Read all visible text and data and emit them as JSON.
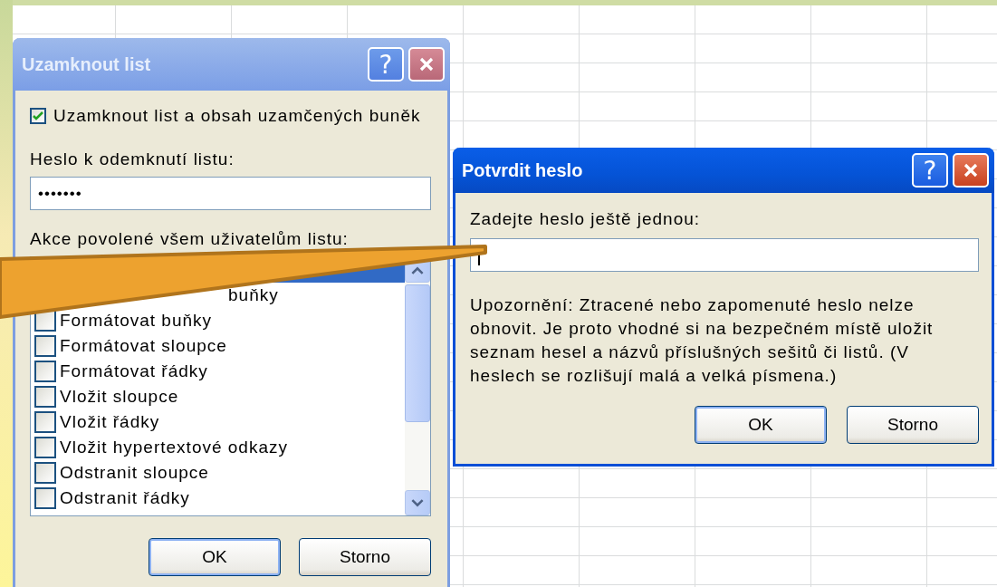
{
  "lock_sheet_dialog": {
    "title": "Uzamknout list",
    "active": false,
    "help_glyph": "?",
    "protect_checkbox": {
      "label": "Uzamknout list a obsah uzamčených buněk",
      "checked": true
    },
    "password_label": "Heslo k odemknutí listu:",
    "password_value": "•••••••",
    "actions_label": "Akce povolené všem uživatelům listu:",
    "actions": [
      {
        "selected": true
      },
      {
        "label": "buňky",
        "selected": false
      },
      {
        "label": "Formátovat buňky",
        "selected": false,
        "checked": false
      },
      {
        "label": "Formátovat sloupce",
        "selected": false,
        "checked": false
      },
      {
        "label": "Formátovat řádky",
        "selected": false,
        "checked": false
      },
      {
        "label": "Vložit sloupce",
        "selected": false,
        "checked": false
      },
      {
        "label": "Vložit řádky",
        "selected": false,
        "checked": false
      },
      {
        "label": "Vložit hypertextové odkazy",
        "selected": false,
        "checked": false
      },
      {
        "label": "Odstranit sloupce",
        "selected": false,
        "checked": false
      },
      {
        "label": "Odstranit řádky",
        "selected": false,
        "checked": false
      }
    ],
    "buttons": [
      "OK",
      "Storno"
    ]
  },
  "confirm_password_dialog": {
    "title": "Potvrdit heslo",
    "active": true,
    "help_glyph": "?",
    "prompt": "Zadejte heslo ještě jednou:",
    "field_focused": true,
    "warning": "Upozornění: Ztracené nebo zapomenuté heslo nelze obnovit. Je proto vhodné si na bezpečném místě uložit seznam hesel a názvů příslušných sešitů či listů. (V heslech se rozlišují malá a velká písmena.)",
    "buttons": [
      "OK",
      "Storno"
    ]
  }
}
